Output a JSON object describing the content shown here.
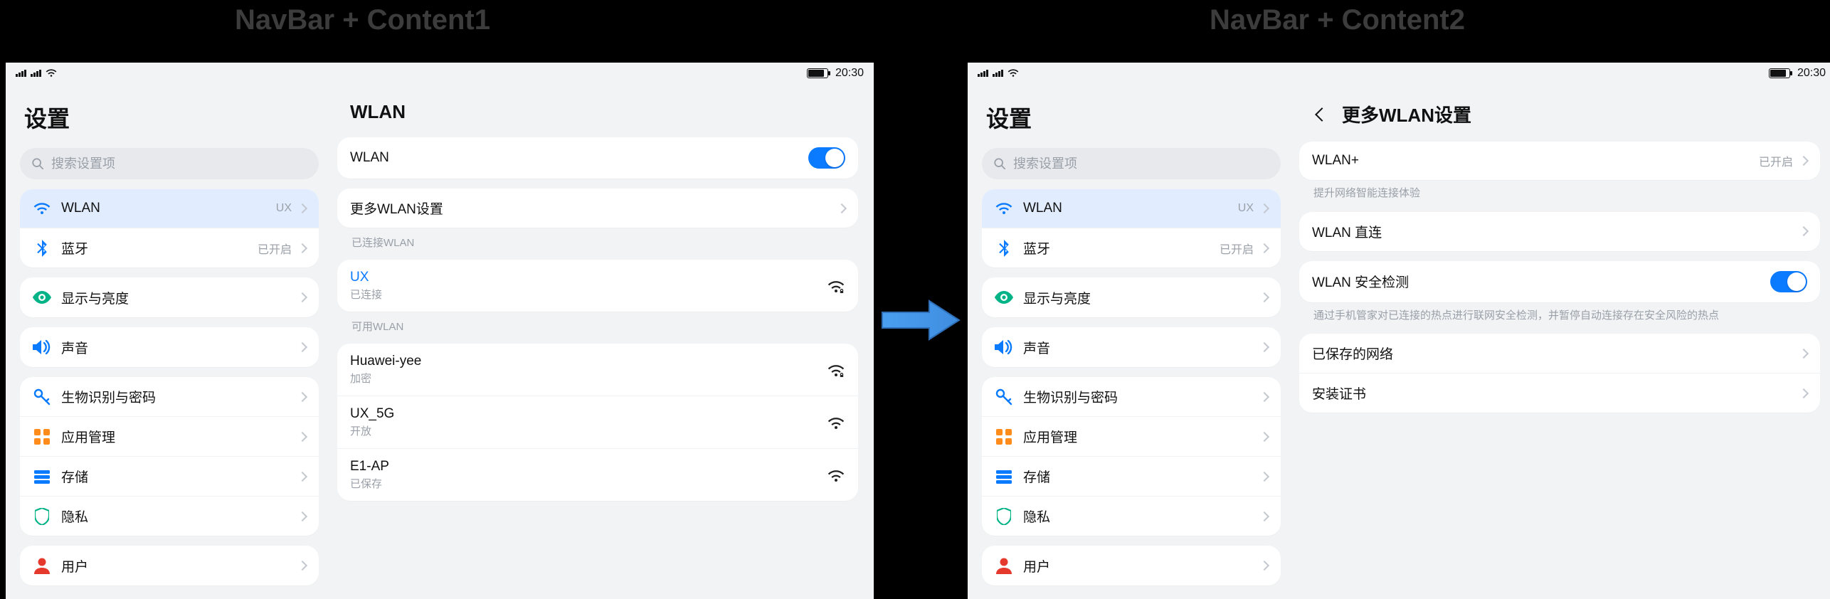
{
  "captions": {
    "left": "NavBar + Content1",
    "right": "NavBar + Content2"
  },
  "status": {
    "time": "20:30"
  },
  "nav": {
    "title": "设置",
    "search_placeholder": "搜索设置项",
    "group1": {
      "wlan": {
        "label": "WLAN",
        "tail": "UX"
      },
      "bluetooth": {
        "label": "蓝牙",
        "tail": "已开启"
      }
    },
    "group2": {
      "display": {
        "label": "显示与亮度"
      },
      "sound": {
        "label": "声音"
      }
    },
    "group3": {
      "biometric": {
        "label": "生物识别与密码"
      },
      "apps": {
        "label": "应用管理"
      },
      "storage": {
        "label": "存储"
      },
      "privacy": {
        "label": "隐私"
      }
    },
    "group4": {
      "user": {
        "label": "用户"
      }
    }
  },
  "content1": {
    "title": "WLAN",
    "wlan_row": {
      "label": "WLAN",
      "on": true
    },
    "more_row": {
      "label": "更多WLAN设置"
    },
    "connected_caption": "已连接WLAN",
    "connected": {
      "ssid": "UX",
      "status": "已连接"
    },
    "available_caption": "可用WLAN",
    "networks": [
      {
        "ssid": "Huawei-yee",
        "status": "加密",
        "locked": true
      },
      {
        "ssid": "UX_5G",
        "status": "开放",
        "locked": false
      },
      {
        "ssid": "E1-AP",
        "status": "已保存",
        "locked": false
      }
    ]
  },
  "content2": {
    "title": "更多WLAN设置",
    "wlan_plus": {
      "label": "WLAN+",
      "tail": "已开启"
    },
    "wlan_plus_hint": "提升网络智能连接体验",
    "direct": {
      "label": "WLAN 直连"
    },
    "security": {
      "label": "WLAN 安全检测",
      "on": true
    },
    "security_hint": "通过手机管家对已连接的热点进行联网安全检测，并暂停自动连接存在安全风险的热点",
    "saved": {
      "label": "已保存的网络"
    },
    "cert": {
      "label": "安装证书"
    }
  },
  "colors": {
    "wifi": "#0a7aff",
    "bluetooth": "#0a7aff",
    "display": "#00b386",
    "sound": "#0a7aff",
    "key": "#0a7aff",
    "apps": "#ff8c1a",
    "storage": "#0a7aff",
    "privacy": "#00b386",
    "user": "#e6392e"
  }
}
